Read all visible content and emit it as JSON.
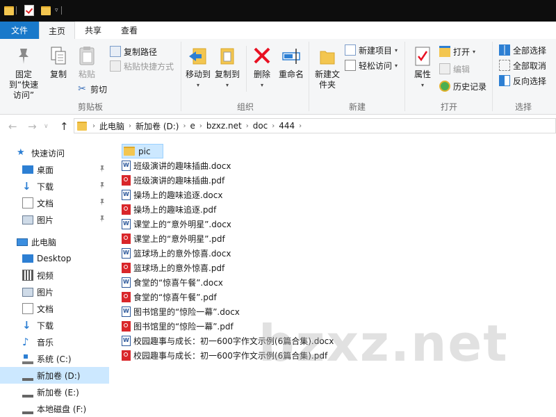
{
  "ribbon": {
    "tabs": [
      {
        "label": "文件"
      },
      {
        "label": "主页"
      },
      {
        "label": "共享"
      },
      {
        "label": "查看"
      }
    ],
    "groups": {
      "clipboard": {
        "label": "剪贴板",
        "pin": "固定到“快速访问”",
        "copy": "复制",
        "paste": "粘贴",
        "copy_path": "复制路径",
        "paste_shortcut": "粘贴快捷方式",
        "cut": "剪切"
      },
      "organize": {
        "label": "组织",
        "move_to": "移动到",
        "copy_to": "复制到",
        "delete": "删除",
        "rename": "重命名"
      },
      "new": {
        "label": "新建",
        "new_folder": "新建文件夹",
        "new_item": "新建项目",
        "easy_access": "轻松访问"
      },
      "open": {
        "label": "打开",
        "properties": "属性",
        "open": "打开",
        "edit": "编辑",
        "history": "历史记录"
      },
      "select": {
        "label": "选择",
        "select_all": "全部选择",
        "select_none": "全部取消",
        "invert": "反向选择"
      }
    }
  },
  "address": {
    "crumbs": [
      "此电脑",
      "新加卷 (D:)",
      "e",
      "bzxz.net",
      "doc",
      "444"
    ]
  },
  "nav": {
    "quick_access": "快速访问",
    "quick_items": [
      "桌面",
      "下载",
      "文档",
      "图片"
    ],
    "this_pc": "此电脑",
    "pc_items": [
      "Desktop",
      "视频",
      "图片",
      "文档",
      "下载",
      "音乐",
      "系统 (C:)",
      "新加卷 (D:)",
      "新加卷 (E:)",
      "本地磁盘 (F:)"
    ]
  },
  "files": [
    {
      "name": "pic",
      "type": "folder"
    },
    {
      "name": "班级演讲的趣味插曲.docx",
      "type": "docx"
    },
    {
      "name": "班级演讲的趣味插曲.pdf",
      "type": "pdf"
    },
    {
      "name": "操场上的趣味追逐.docx",
      "type": "docx"
    },
    {
      "name": "操场上的趣味追逐.pdf",
      "type": "pdf"
    },
    {
      "name": "课堂上的“意外明星”.docx",
      "type": "docx"
    },
    {
      "name": "课堂上的“意外明星”.pdf",
      "type": "pdf"
    },
    {
      "name": "篮球场上的意外惊喜.docx",
      "type": "docx"
    },
    {
      "name": "篮球场上的意外惊喜.pdf",
      "type": "pdf"
    },
    {
      "name": "食堂的“惊喜午餐”.docx",
      "type": "docx"
    },
    {
      "name": "食堂的“惊喜午餐”.pdf",
      "type": "pdf"
    },
    {
      "name": "图书馆里的“惊险一幕”.docx",
      "type": "docx"
    },
    {
      "name": "图书馆里的“惊险一幕”.pdf",
      "type": "pdf"
    },
    {
      "name": "校园趣事与成长：初一600字作文示例(6篇合集).docx",
      "type": "docx"
    },
    {
      "name": "校园趣事与成长：初一600字作文示例(6篇合集).pdf",
      "type": "pdf"
    }
  ],
  "watermark": "bzxz.net",
  "colors": {
    "accent": "#1979ca",
    "selection": "#cce8ff",
    "folder": "#f3c650",
    "pdf": "#d9262a",
    "word": "#2b579a",
    "delete_red": "#e81123"
  }
}
